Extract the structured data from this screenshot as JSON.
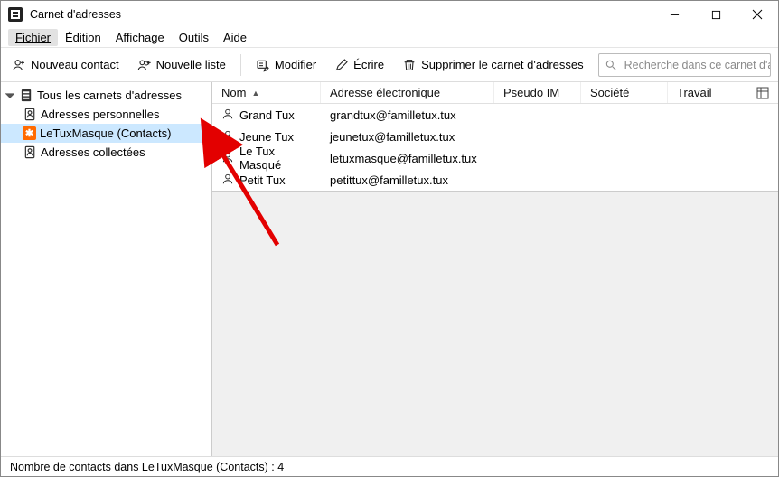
{
  "window": {
    "title": "Carnet d'adresses"
  },
  "menu": {
    "fichier": "Fichier",
    "edition": "Édition",
    "affichage": "Affichage",
    "outils": "Outils",
    "aide": "Aide"
  },
  "toolbar": {
    "nouveau_contact": "Nouveau contact",
    "nouvelle_liste": "Nouvelle liste",
    "modifier": "Modifier",
    "ecrire": "Écrire",
    "supprimer": "Supprimer le carnet d'adresses"
  },
  "search": {
    "placeholder": "Recherche dans ce carnet d'adresse et dans"
  },
  "sidebar": {
    "root": "Tous les carnets d'adresses",
    "items": [
      {
        "label": "Adresses personnelles",
        "kind": "personal",
        "selected": false
      },
      {
        "label": "LeTuxMasque (Contacts)",
        "kind": "remote",
        "selected": true
      },
      {
        "label": "Adresses collectées",
        "kind": "personal",
        "selected": false
      }
    ]
  },
  "columns": {
    "nom": "Nom",
    "email": "Adresse électronique",
    "im": "Pseudo IM",
    "societe": "Société",
    "travail": "Travail"
  },
  "contacts": [
    {
      "nom": "Grand Tux",
      "email": "grandtux@familletux.tux"
    },
    {
      "nom": "Jeune Tux",
      "email": "jeunetux@familletux.tux"
    },
    {
      "nom": "Le Tux Masqué",
      "email": "letuxmasque@familletux.tux"
    },
    {
      "nom": "Petit Tux",
      "email": "petittux@familletux.tux"
    }
  ],
  "status": {
    "text": "Nombre de contacts dans LeTuxMasque (Contacts) : 4"
  }
}
